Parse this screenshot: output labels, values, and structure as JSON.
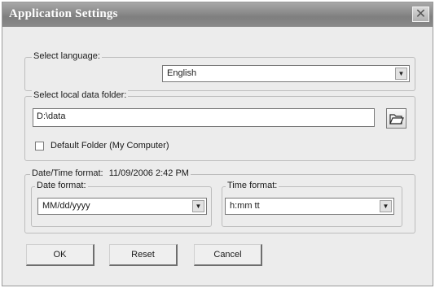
{
  "window": {
    "title": "Application Settings",
    "close_glyph": "✕"
  },
  "language": {
    "label": "Select language:",
    "selected": "English"
  },
  "data_folder": {
    "label": "Select local data folder:",
    "value": "D:\\data",
    "default_checkbox_label": "Default Folder (My Computer)",
    "default_checked": false
  },
  "datetime": {
    "label": "Date/Time format:",
    "sample": "11/09/2006 2:42 PM",
    "date_format_label": "Date format:",
    "date_format_value": "MM/dd/yyyy",
    "time_format_label": "Time format:",
    "time_format_value": "h:mm tt"
  },
  "buttons": {
    "ok": "OK",
    "reset": "Reset",
    "cancel": "Cancel"
  },
  "icons": {
    "dropdown": "chevron-down-icon",
    "folder": "folder-open-icon",
    "close": "close-icon"
  }
}
